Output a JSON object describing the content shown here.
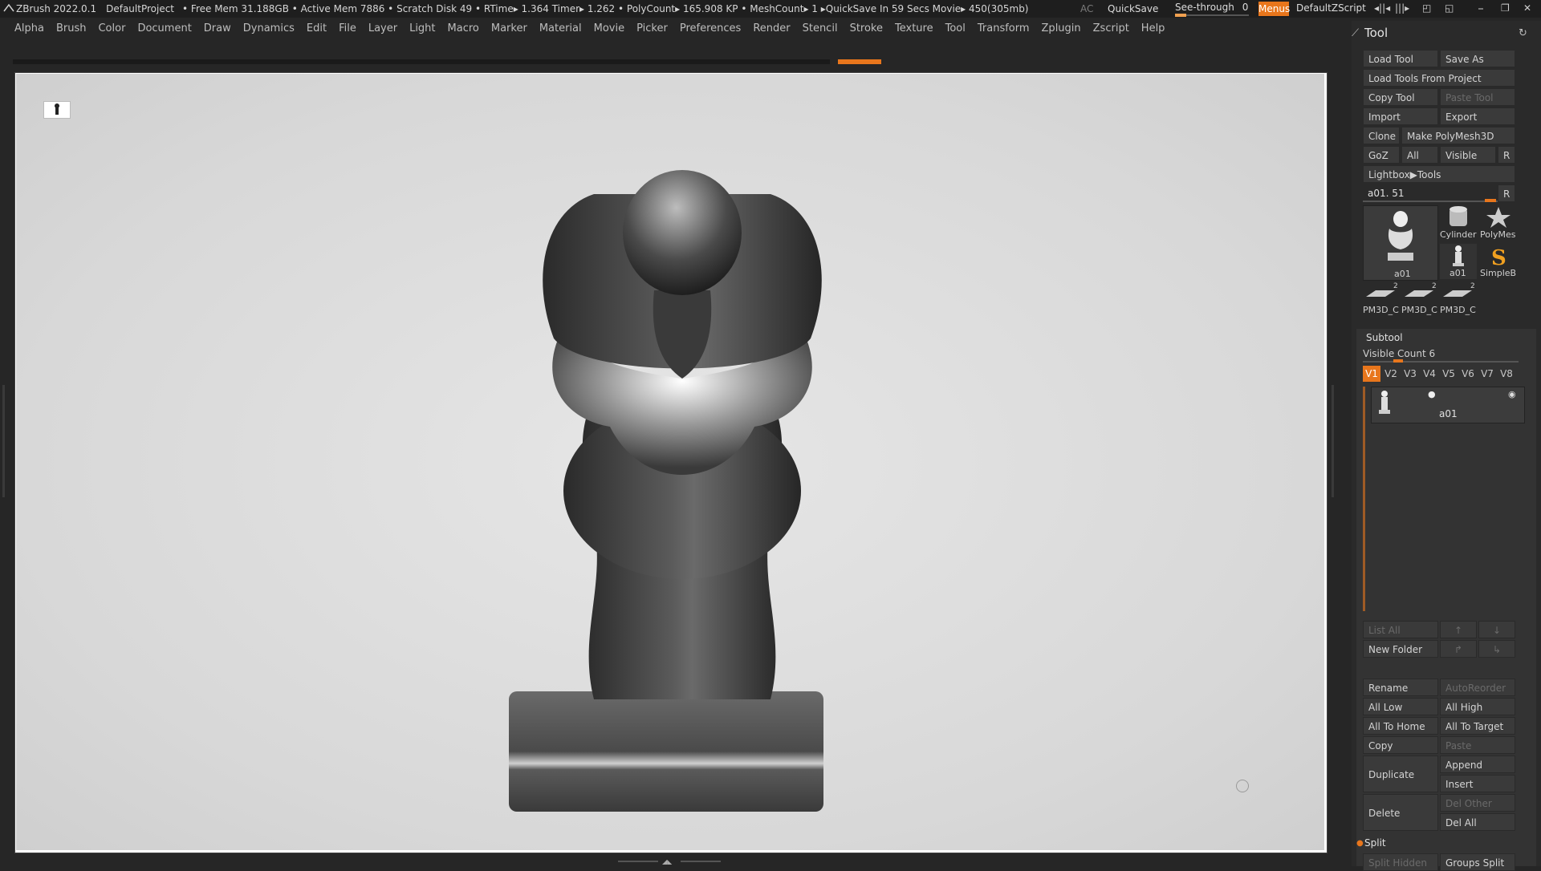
{
  "titlebar": {
    "app": "ZBrush 2022.0.1",
    "project": "DefaultProject",
    "status": "• Free Mem 31.188GB • Active Mem 7886 • Scratch Disk 49 •  RTime▸ 1.364 Timer▸ 1.262 • PolyCount▸ 165.908 KP  • MeshCount▸ 1  ▸QuickSave In 59 Secs Movie▸ 450(305mb)",
    "ac": "AC",
    "quicksave": "QuickSave",
    "seethrough_label": "See-through",
    "seethrough_value": "0",
    "seethrough_fraction": 0,
    "menus": "Menus",
    "defaultzscript": "DefaultZScript"
  },
  "menubar": [
    "Alpha",
    "Brush",
    "Color",
    "Document",
    "Draw",
    "Dynamics",
    "Edit",
    "File",
    "Layer",
    "Light",
    "Macro",
    "Marker",
    "Material",
    "Movie",
    "Picker",
    "Preferences",
    "Render",
    "Stencil",
    "Stroke",
    "Texture",
    "Tool",
    "Transform",
    "Zplugin",
    "Zscript",
    "Help"
  ],
  "tool_panel": {
    "title": "Tool",
    "buttons": {
      "load_tool": "Load Tool",
      "save_as": "Save As",
      "load_tools_from_project": "Load Tools From Project",
      "copy_tool": "Copy Tool",
      "paste_tool": "Paste Tool",
      "import": "Import",
      "export": "Export",
      "clone": "Clone",
      "make_polymesh3d": "Make PolyMesh3D",
      "goz": "GoZ",
      "all": "All",
      "visible": "Visible",
      "r": "R",
      "lightbox_tools": "Lightbox▶Tools"
    },
    "current_tool": "a01. 51",
    "slider_r": "R",
    "tools": [
      {
        "name": "a01",
        "icon": "figure-icon"
      },
      {
        "name": "Cylinder",
        "icon": "cylinder-icon"
      },
      {
        "name": "PolyMes",
        "icon": "star-icon"
      },
      {
        "name": "a01",
        "icon": "figure-small-icon"
      },
      {
        "name": "SimpleB",
        "icon": "simplebrush-icon"
      },
      {
        "name": "PM3D_C",
        "icon": "plane-icon",
        "badge": "2"
      },
      {
        "name": "PM3D_C",
        "icon": "plane-icon",
        "badge": "2"
      },
      {
        "name": "PM3D_C",
        "icon": "plane-icon",
        "badge": "2"
      }
    ]
  },
  "subtool": {
    "title": "Subtool",
    "visible_count": "Visible Count 6",
    "vtabs": [
      "V1",
      "V2",
      "V3",
      "V4",
      "V5",
      "V6",
      "V7",
      "V8"
    ],
    "item_name": "a01",
    "list_all": "List All",
    "new_folder": "New Folder",
    "rename": "Rename",
    "autoreorder": "AutoReorder",
    "all_low": "All Low",
    "all_high": "All High",
    "all_to_home": "All To Home",
    "all_to_target": "All To Target",
    "copy": "Copy",
    "paste": "Paste",
    "duplicate": "Duplicate",
    "append": "Append",
    "insert": "Insert",
    "delete": "Delete",
    "del_other": "Del Other",
    "del_all": "Del All",
    "split": "Split",
    "split_hidden": "Split Hidden",
    "groups_split": "Groups Split"
  },
  "colors": {
    "accent": "#e8761c",
    "panel": "#2a2a2a",
    "canvas": "#d9d9d9"
  }
}
